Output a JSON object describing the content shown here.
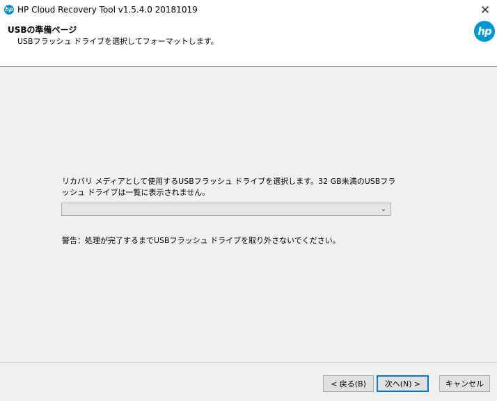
{
  "window": {
    "app_icon": "hp-icon",
    "title": "HP Cloud Recovery Tool v1.5.4.0 20181019",
    "close_glyph": "✕"
  },
  "header": {
    "title": "USBの準備ページ",
    "subtitle": "USBフラッシュ ドライブを選択してフォーマットします。",
    "logo_text": "hp"
  },
  "main": {
    "instruction": "リカバリ メディアとして使用するUSBフラッシュ ドライブを選択します。32 GB未満のUSBフラッシュ ドライブは一覧に表示されません。",
    "drive_select": {
      "selected": "",
      "chevron_glyph": "⌄"
    },
    "warning": "警告：処理が完了するまでUSBフラッシュ ドライブを取り外さないでください。"
  },
  "footer": {
    "back_label": "< 戻る(B)",
    "next_label": "次へ(N) >",
    "cancel_label": "キャンセル"
  },
  "colors": {
    "hp_blue": "#0096d6",
    "focus_border": "#0078d7",
    "panel_bg": "#f0f0f0"
  }
}
